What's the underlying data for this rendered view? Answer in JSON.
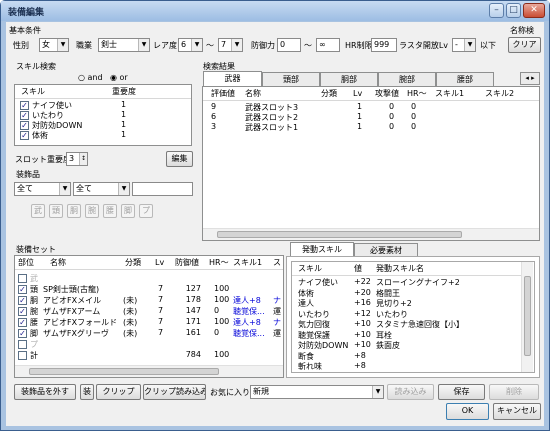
{
  "window": {
    "title": "装備編集"
  },
  "basic": {
    "label": "基本条件",
    "gender_label": "性別",
    "gender": "女",
    "job_label": "職業",
    "job": "剣士",
    "rare_label": "レア度",
    "rare_min": "6",
    "rare_sep": "〜",
    "rare_max": "7",
    "def_label": "防御力",
    "def_min": "0",
    "def_sep": "〜",
    "def_max": "∞",
    "hr_label": "HR制限",
    "hr": "999",
    "slot_label": "ラスタ開放Lv",
    "slot": "-",
    "slot_suffix": "以下",
    "name_search_label": "名称検",
    "clear": "クリア"
  },
  "skill_search": {
    "label": "スキル検索",
    "and": "and",
    "or": "or",
    "mode": "or",
    "col_skill": "スキル",
    "col_importance": "重要度",
    "rows": [
      {
        "name": "ナイフ使い",
        "val": "1",
        "checked": true
      },
      {
        "name": "いたわり",
        "val": "1",
        "checked": true
      },
      {
        "name": "対防効DOWN",
        "val": "1",
        "checked": true
      },
      {
        "name": "体術",
        "val": "1",
        "checked": true
      }
    ],
    "slot_importance_label": "スロット重要度",
    "slot_importance": "3",
    "edit": "編集"
  },
  "decor": {
    "label": "装飾品",
    "combo1": "全て",
    "combo2": "全て",
    "buttons": [
      "武",
      "頭",
      "胴",
      "腕",
      "腰",
      "脚",
      "プ"
    ]
  },
  "results": {
    "label": "検索結果",
    "tabs": [
      "武器",
      "頭部",
      "胴部",
      "腕部",
      "腰部"
    ],
    "headers": [
      "評価値",
      "名称",
      "分類",
      "Lv",
      "攻撃値",
      "HR〜",
      "スキル1",
      "スキル2"
    ],
    "rows": [
      [
        "9",
        "武器スロット3",
        "",
        "1",
        "0",
        "0",
        "",
        ""
      ],
      [
        "6",
        "武器スロット2",
        "",
        "1",
        "0",
        "0",
        "",
        ""
      ],
      [
        "3",
        "武器スロット1",
        "",
        "1",
        "0",
        "0",
        "",
        ""
      ]
    ]
  },
  "equip": {
    "label": "装備セット",
    "headers": [
      "部位",
      "名称",
      "分類",
      "Lv",
      "防御値",
      "HR〜",
      "スキル1",
      "ス"
    ],
    "rows": [
      {
        "part": "武",
        "name": "",
        "cls": "",
        "lv": "",
        "def": "",
        "hr": "",
        "s1": "",
        "s2": "",
        "checked": false,
        "dim": true
      },
      {
        "part": "頭",
        "name": "SP剣士頭(古龍)",
        "cls": "",
        "lv": "7",
        "def": "127",
        "hr": "100",
        "s1": "",
        "s2": "",
        "checked": true
      },
      {
        "part": "胴",
        "name": "アビオFXメイル",
        "cls": "(未)",
        "lv": "7",
        "def": "178",
        "hr": "100",
        "s1": "達人+8",
        "s2": "ナ",
        "checked": true
      },
      {
        "part": "腕",
        "name": "ザムザFXアーム",
        "cls": "(未)",
        "lv": "7",
        "def": "147",
        "hr": "0",
        "s1": "聴覚保...",
        "s2": "運",
        "checked": true
      },
      {
        "part": "腰",
        "name": "アビオFXフォールド",
        "cls": "(未)",
        "lv": "7",
        "def": "171",
        "hr": "100",
        "s1": "達人+8",
        "s2": "ナ",
        "checked": true
      },
      {
        "part": "脚",
        "name": "ザムザFXグリーヴ",
        "cls": "(未)",
        "lv": "7",
        "def": "161",
        "hr": "0",
        "s1": "聴覚保...",
        "s2": "運",
        "checked": true
      },
      {
        "part": "プ",
        "name": "",
        "cls": "",
        "lv": "",
        "def": "",
        "hr": "",
        "s1": "",
        "s2": "",
        "checked": false,
        "dim": true
      },
      {
        "part": "計",
        "name": "",
        "cls": "",
        "lv": "",
        "def": "784",
        "hr": "100",
        "s1": "",
        "s2": "",
        "checked": false
      }
    ]
  },
  "skills_tabs": [
    "発動スキル",
    "必要素材"
  ],
  "skills": {
    "headers": [
      "スキル",
      "値",
      "発動スキル名"
    ],
    "rows": [
      [
        "ナイフ使い",
        "+22",
        "スローイングナイフ+2"
      ],
      [
        "体術",
        "+20",
        "格闘王"
      ],
      [
        "達人",
        "+16",
        "見切り+2"
      ],
      [
        "いたわり",
        "+12",
        "いたわり"
      ],
      [
        "気力回復",
        "+10",
        "スタミナ急速回復【小】"
      ],
      [
        "聴覚保護",
        "+10",
        "耳栓"
      ],
      [
        "対防効DOWN",
        "+10",
        "鉄面皮"
      ],
      [
        "断食",
        "+8",
        ""
      ],
      [
        "斬れ味",
        "+8",
        ""
      ]
    ]
  },
  "bottom": {
    "remove": "装飾品を外す",
    "kiso": "装",
    "clip": "クリップ",
    "clip_load": "クリップ読み込み",
    "fav_label": "お気に入り",
    "fav_value": "新規",
    "load": "読み込み",
    "save": "保存",
    "delete": "削除",
    "ok": "OK",
    "cancel": "キャンセル"
  }
}
